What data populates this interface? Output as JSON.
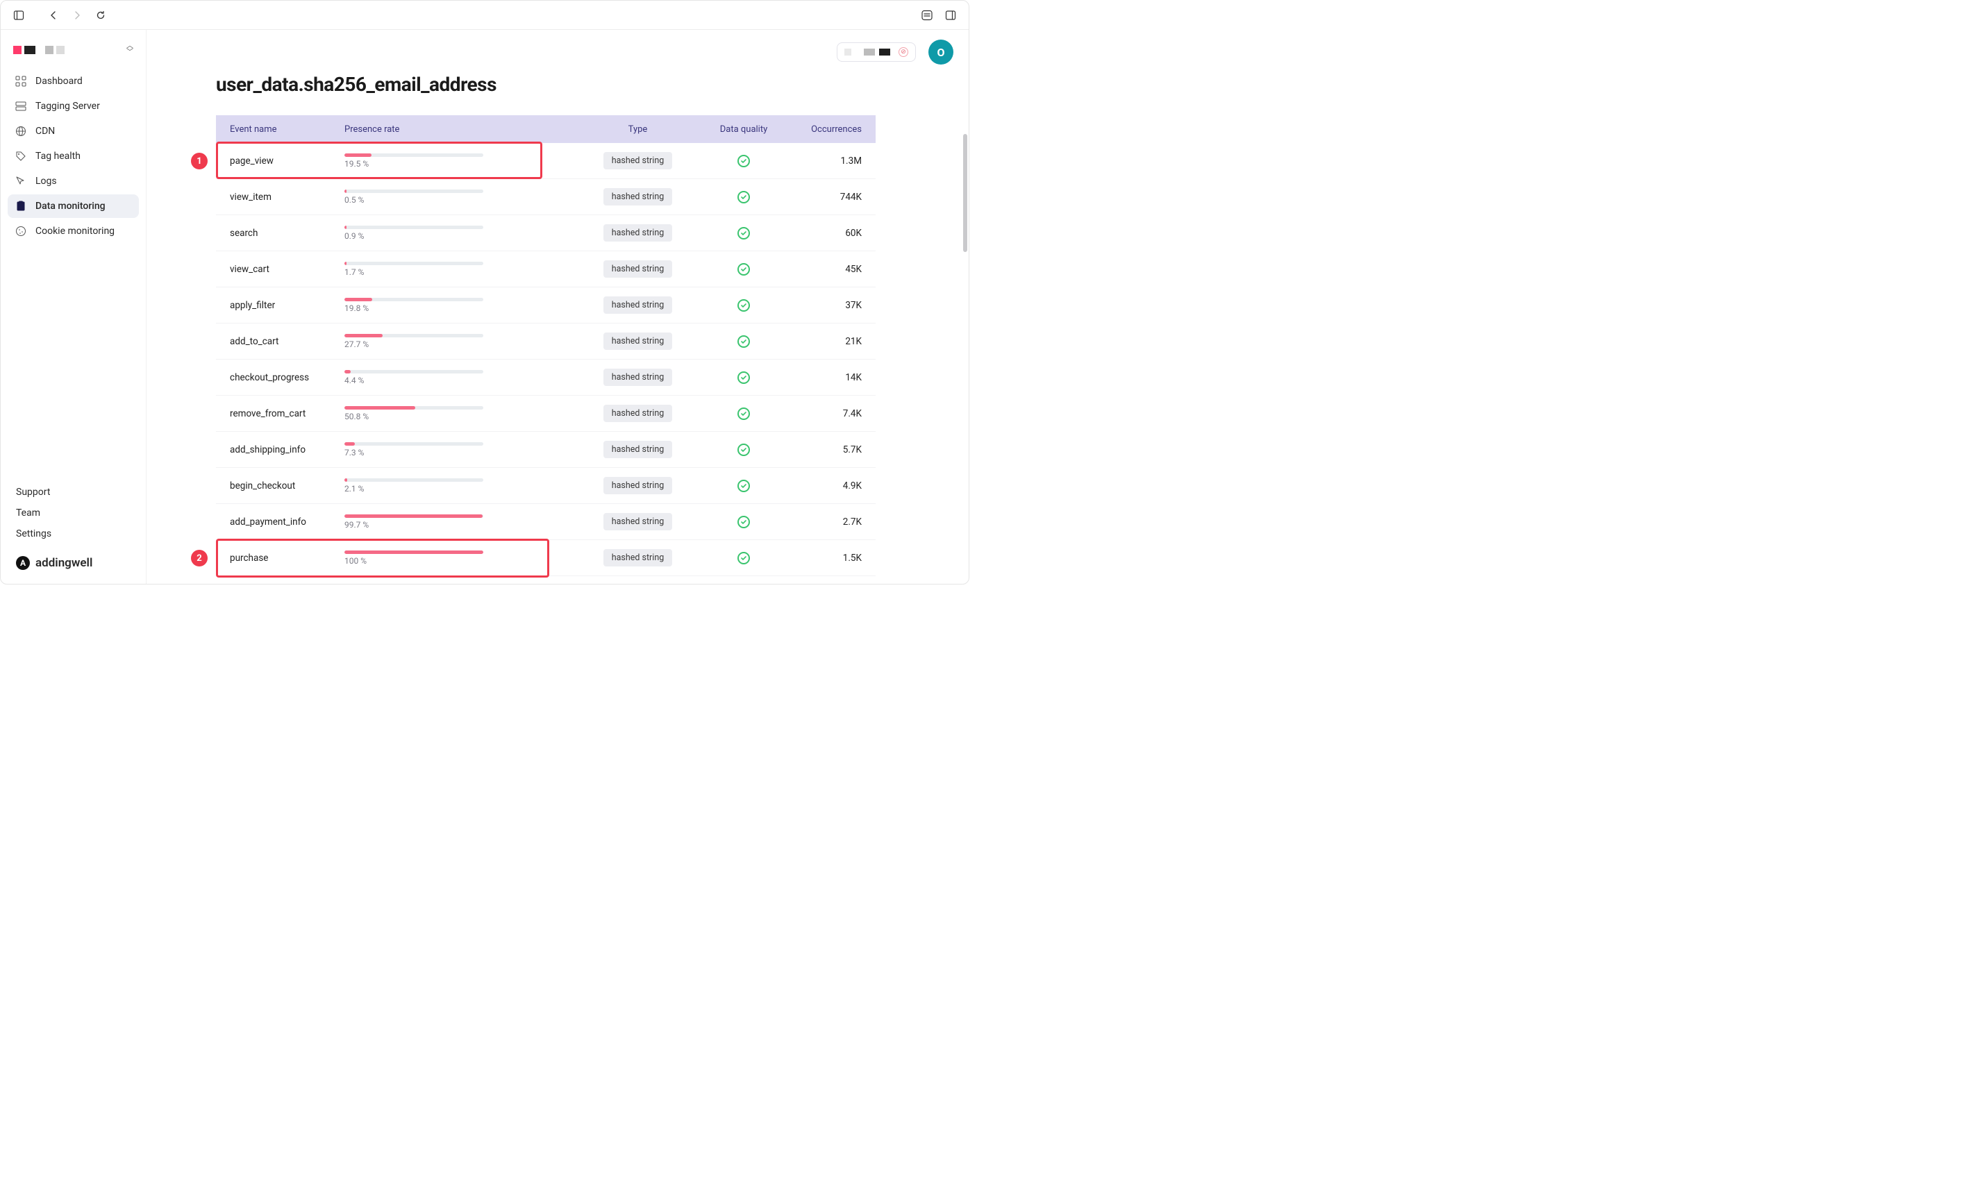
{
  "page_title": "user_data.sha256_email_address",
  "avatar_initial": "O",
  "brand": "addingwell",
  "sidebar": {
    "items": [
      {
        "label": "Dashboard"
      },
      {
        "label": "Tagging Server"
      },
      {
        "label": "CDN"
      },
      {
        "label": "Tag health"
      },
      {
        "label": "Logs"
      },
      {
        "label": "Data monitoring"
      },
      {
        "label": "Cookie monitoring"
      }
    ],
    "footer": {
      "support": "Support",
      "team": "Team",
      "settings": "Settings"
    }
  },
  "columns": {
    "event": "Event name",
    "presence": "Presence rate",
    "type": "Type",
    "quality": "Data quality",
    "occurrences": "Occurrences"
  },
  "rows": [
    {
      "name": "page_view",
      "presence_pct": 19.5,
      "presence_label": "19.5 %",
      "type": "hashed string",
      "occurrences": "1.3M"
    },
    {
      "name": "view_item",
      "presence_pct": 0.5,
      "presence_label": "0.5 %",
      "type": "hashed string",
      "occurrences": "744K"
    },
    {
      "name": "search",
      "presence_pct": 0.9,
      "presence_label": "0.9 %",
      "type": "hashed string",
      "occurrences": "60K"
    },
    {
      "name": "view_cart",
      "presence_pct": 1.7,
      "presence_label": "1.7 %",
      "type": "hashed string",
      "occurrences": "45K"
    },
    {
      "name": "apply_filter",
      "presence_pct": 19.8,
      "presence_label": "19.8 %",
      "type": "hashed string",
      "occurrences": "37K"
    },
    {
      "name": "add_to_cart",
      "presence_pct": 27.7,
      "presence_label": "27.7 %",
      "type": "hashed string",
      "occurrences": "21K"
    },
    {
      "name": "checkout_progress",
      "presence_pct": 4.4,
      "presence_label": "4.4 %",
      "type": "hashed string",
      "occurrences": "14K"
    },
    {
      "name": "remove_from_cart",
      "presence_pct": 50.8,
      "presence_label": "50.8 %",
      "type": "hashed string",
      "occurrences": "7.4K"
    },
    {
      "name": "add_shipping_info",
      "presence_pct": 7.3,
      "presence_label": "7.3 %",
      "type": "hashed string",
      "occurrences": "5.7K"
    },
    {
      "name": "begin_checkout",
      "presence_pct": 2.1,
      "presence_label": "2.1 %",
      "type": "hashed string",
      "occurrences": "4.9K"
    },
    {
      "name": "add_payment_info",
      "presence_pct": 99.7,
      "presence_label": "99.7 %",
      "type": "hashed string",
      "occurrences": "2.7K"
    },
    {
      "name": "purchase",
      "presence_pct": 100,
      "presence_label": "100 %",
      "type": "hashed string",
      "occurrences": "1.5K"
    }
  ],
  "annotations": {
    "one": "1",
    "two": "2"
  }
}
